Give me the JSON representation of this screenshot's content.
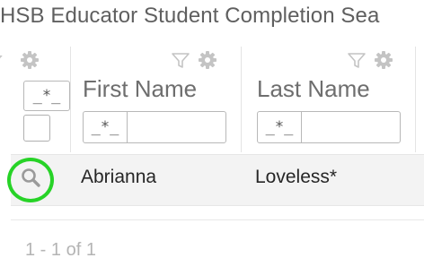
{
  "page": {
    "title": "HSB Educator Student Completion Sea"
  },
  "table": {
    "columns": [
      {
        "label": "First Name",
        "filter_placeholder": "_*_"
      },
      {
        "label": "Last Name",
        "filter_placeholder": "_*_"
      }
    ],
    "selector_column": {
      "filter_placeholder": "_*_"
    },
    "rows": [
      {
        "first_name": "Abrianna",
        "last_name": "Loveless*",
        "action_icon": "search-icon"
      }
    ]
  },
  "pager": {
    "text": "1 - 1 of 1"
  },
  "icons": {
    "filter": "filter-icon",
    "settings": "gear-icon",
    "row_action": "search-icon"
  },
  "colors": {
    "highlight_ring": "#27d327",
    "row_background": "#f3f3f3",
    "title": "#5f5f5f"
  }
}
